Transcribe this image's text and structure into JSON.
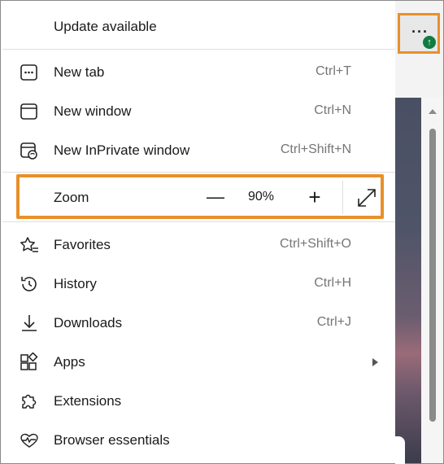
{
  "menu": {
    "update": {
      "label": "Update available"
    },
    "items": [
      {
        "label": "New tab",
        "shortcut": "Ctrl+T",
        "icon": "new-tab-icon"
      },
      {
        "label": "New window",
        "shortcut": "Ctrl+N",
        "icon": "window-icon"
      },
      {
        "label": "New InPrivate window",
        "shortcut": "Ctrl+Shift+N",
        "icon": "inprivate-icon"
      }
    ],
    "zoom": {
      "label": "Zoom",
      "value": "90%",
      "minus": "—",
      "plus": "+"
    },
    "items2": [
      {
        "label": "Favorites",
        "shortcut": "Ctrl+Shift+O",
        "icon": "favorites-icon"
      },
      {
        "label": "History",
        "shortcut": "Ctrl+H",
        "icon": "history-icon"
      },
      {
        "label": "Downloads",
        "shortcut": "Ctrl+J",
        "icon": "download-icon"
      },
      {
        "label": "Apps",
        "shortcut": "",
        "icon": "apps-icon"
      },
      {
        "label": "Extensions",
        "shortcut": "",
        "icon": "extensions-icon"
      },
      {
        "label": "Browser essentials",
        "shortcut": "",
        "icon": "heart-pulse-icon"
      }
    ]
  },
  "toolbar": {
    "more_label": "···",
    "badge": "↑"
  },
  "colors": {
    "highlight": "#e8902a",
    "badge": "#107c41"
  }
}
